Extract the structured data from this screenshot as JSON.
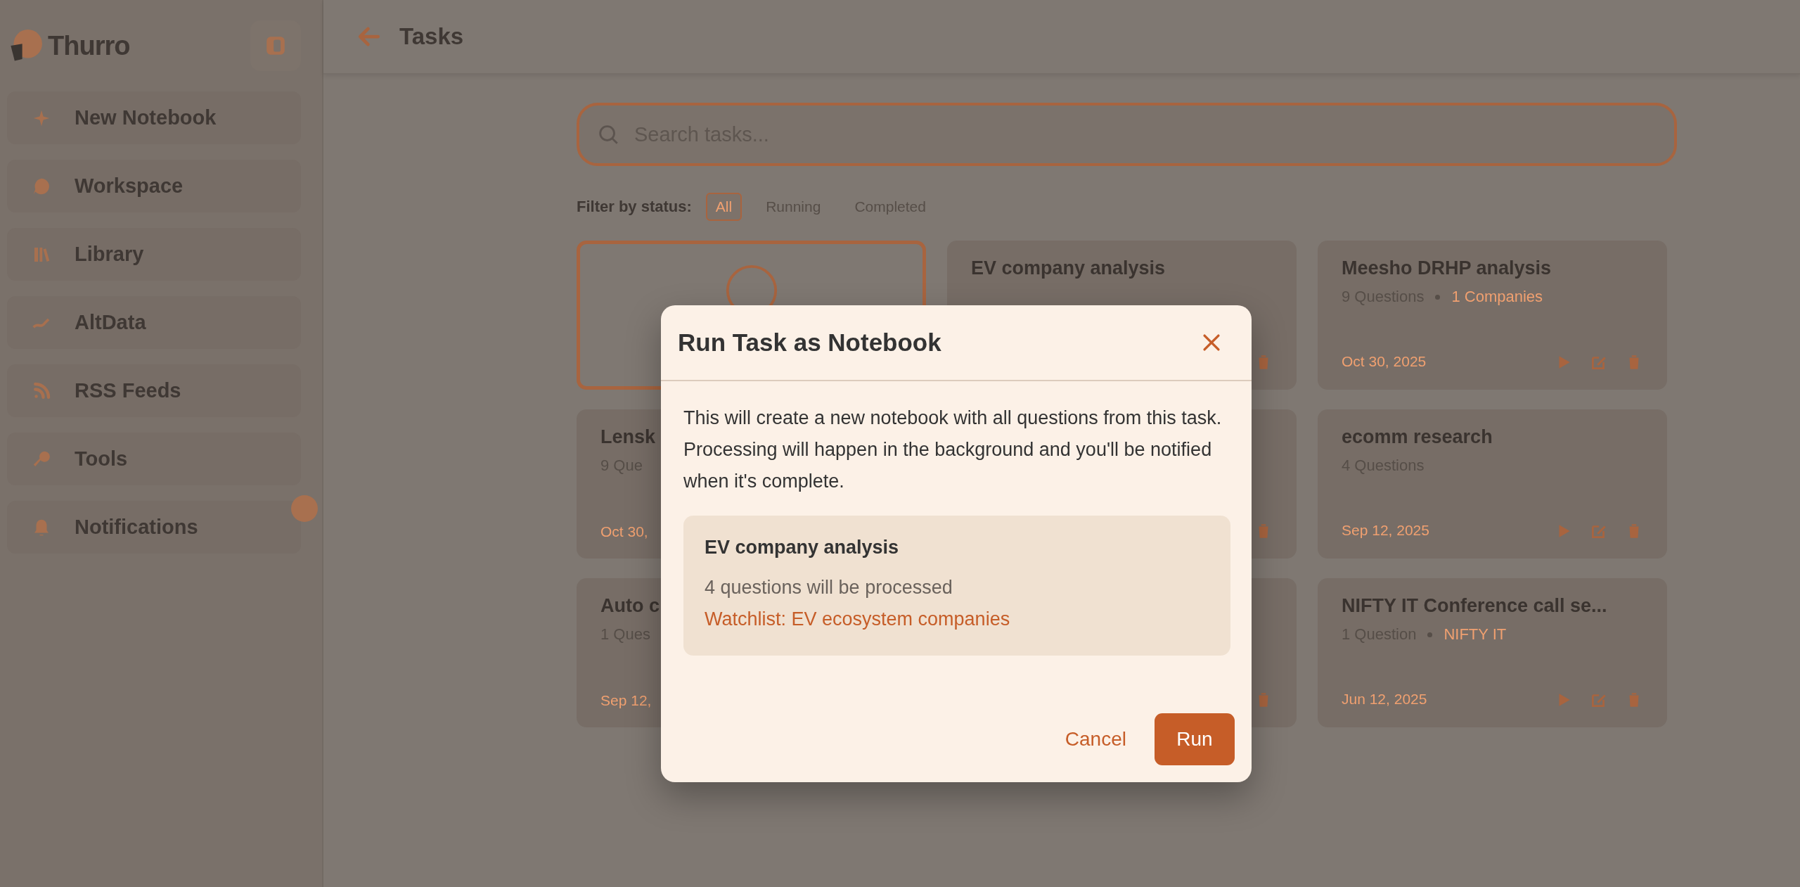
{
  "sidebar": {
    "brand": "Thurro",
    "items": [
      {
        "label": "New Notebook",
        "badge": false
      },
      {
        "label": "Workspace",
        "badge": false
      },
      {
        "label": "Library",
        "badge": false
      },
      {
        "label": "AltData",
        "badge": false
      },
      {
        "label": "RSS Feeds",
        "badge": false
      },
      {
        "label": "Tools",
        "badge": false
      },
      {
        "label": "Notifications",
        "badge": true
      }
    ]
  },
  "header": {
    "title": "Tasks"
  },
  "search": {
    "placeholder": "Search tasks..."
  },
  "filter": {
    "label": "Filter by status:",
    "options": [
      {
        "label": "All",
        "selected": true
      },
      {
        "label": "Running",
        "selected": false
      },
      {
        "label": "Completed",
        "selected": false
      }
    ]
  },
  "task_cards": [
    {
      "kind": "new"
    },
    {
      "kind": "covered",
      "title": "EV company analysis"
    },
    {
      "kind": "full",
      "title": "Meesho DRHP analysis",
      "questions": "9 Questions",
      "watchlist": "1 Companies",
      "date": "Oct 30, 2025"
    },
    {
      "kind": "partial",
      "title": "Lensk",
      "questions": "9 Que",
      "date": "Oct 30,"
    },
    {
      "kind": "covered"
    },
    {
      "kind": "full",
      "title": "ecomm research",
      "questions": "4 Questions",
      "date": "Sep 12, 2025"
    },
    {
      "kind": "partial",
      "title": "Auto c",
      "questions": "1 Ques",
      "date": "Sep 12,"
    },
    {
      "kind": "covered"
    },
    {
      "kind": "full",
      "title": "NIFTY IT Conference call se...",
      "questions": "1 Question",
      "watchlist": "NIFTY IT",
      "date": "Jun 12, 2025"
    }
  ],
  "dialog": {
    "title": "Run Task as Notebook",
    "message": "This will create a new notebook with all questions from this task. Processing will happen in the background and you'll be notified when it's complete.",
    "task_name": "EV company analysis",
    "question_count": "4 questions will be processed",
    "watchlist": "Watchlist: EV ecosystem companies",
    "buttons": {
      "cancel": "Cancel",
      "run": "Run"
    }
  }
}
